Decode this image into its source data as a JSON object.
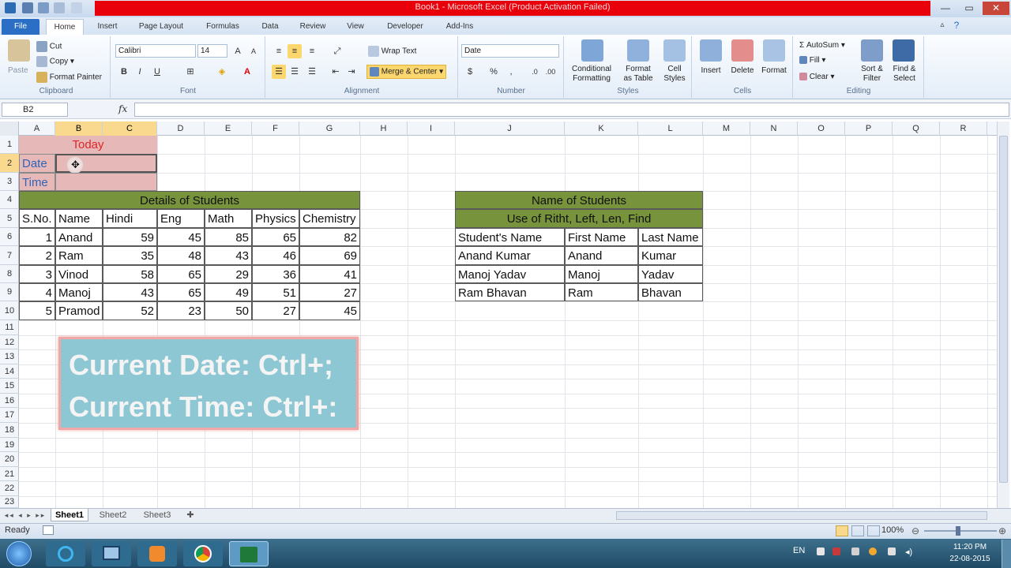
{
  "window": {
    "title": "Book1 - Microsoft Excel (Product Activation Failed)"
  },
  "tabs": [
    "File",
    "Home",
    "Insert",
    "Page Layout",
    "Formulas",
    "Data",
    "Review",
    "View",
    "Developer",
    "Add-Ins"
  ],
  "ribbon": {
    "clipboard": {
      "label": "Clipboard",
      "paste": "Paste",
      "cut": "Cut",
      "copy": "Copy",
      "format_painter": "Format Painter"
    },
    "font": {
      "label": "Font",
      "name": "Calibri",
      "size": "14"
    },
    "alignment": {
      "label": "Alignment",
      "wrap": "Wrap Text",
      "merge": "Merge & Center"
    },
    "number": {
      "label": "Number",
      "format": "Date"
    },
    "styles": {
      "label": "Styles",
      "conditional": [
        "Conditional",
        "Formatting"
      ],
      "format_table": [
        "Format",
        "as Table"
      ],
      "cell_styles": [
        "Cell",
        "Styles"
      ]
    },
    "cells": {
      "label": "Cells",
      "insert": "Insert",
      "delete": "Delete",
      "format": "Format"
    },
    "editing": {
      "label": "Editing",
      "autosum": "AutoSum",
      "fill": "Fill",
      "clear": "Clear",
      "sort": [
        "Sort &",
        "Filter"
      ],
      "find": [
        "Find &",
        "Select"
      ]
    }
  },
  "formula": {
    "namebox": "B2",
    "fx": "fx",
    "value": ""
  },
  "columns": [
    "A",
    "B",
    "C",
    "D",
    "E",
    "F",
    "G",
    "H",
    "I",
    "J",
    "K",
    "L",
    "M",
    "N",
    "O",
    "P",
    "Q",
    "R"
  ],
  "rows": [
    "1",
    "2",
    "3",
    "4",
    "5",
    "6",
    "7",
    "8",
    "9",
    "10",
    "11",
    "12",
    "13",
    "14",
    "15",
    "16",
    "17",
    "18",
    "19",
    "20",
    "21",
    "22",
    "23"
  ],
  "cells": {
    "today": "Today",
    "date": "Date",
    "time": "Time"
  },
  "students_table": {
    "title": "Details of Students",
    "headers": [
      "S.No.",
      "Name",
      "Hindi",
      "Eng",
      "Math",
      "Physics",
      "Chemistry"
    ],
    "rows": [
      [
        "1",
        "Anand",
        "59",
        "45",
        "85",
        "65",
        "82"
      ],
      [
        "2",
        "Ram",
        "35",
        "48",
        "43",
        "46",
        "69"
      ],
      [
        "3",
        "Vinod",
        "58",
        "65",
        "29",
        "36",
        "41"
      ],
      [
        "4",
        "Manoj",
        "43",
        "65",
        "49",
        "51",
        "27"
      ],
      [
        "5",
        "Pramod",
        "52",
        "23",
        "50",
        "27",
        "45"
      ]
    ]
  },
  "names_table": {
    "title": "Name of Students",
    "subtitle": "Use of Ritht, Left, Len, Find",
    "headers": [
      "Student's Name",
      "First Name",
      "Last Name"
    ],
    "rows": [
      [
        "Anand Kumar",
        "Anand",
        "Kumar"
      ],
      [
        "Manoj Yadav",
        "Manoj",
        "Yadav"
      ],
      [
        "Ram Bhavan",
        "Ram",
        "Bhavan"
      ]
    ]
  },
  "callout": {
    "line1": "Current Date: Ctrl+;",
    "line2": "Current Time: Ctrl+:"
  },
  "sheets": [
    "Sheet1",
    "Sheet2",
    "Sheet3"
  ],
  "status": {
    "ready": "Ready",
    "zoom": "100%"
  },
  "taskbar": {
    "lang": "EN",
    "time": "11:20 PM",
    "date": "22-08-2015"
  },
  "colors": {
    "title_red": "#e8000b",
    "green_header": "#77933c",
    "pink_fill": "#e6b9b8",
    "callout_bg": "#8cc7d3"
  }
}
